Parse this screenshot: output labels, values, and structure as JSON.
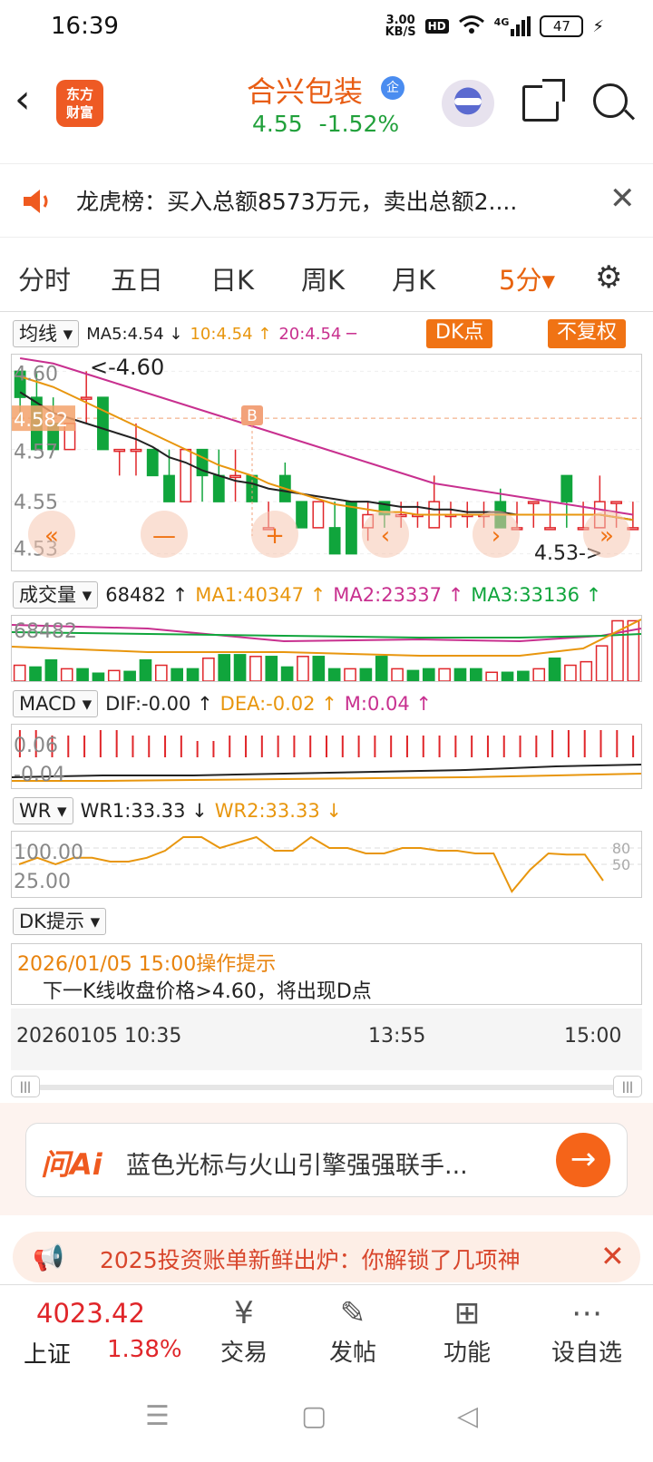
{
  "status_bar": {
    "time": "16:39",
    "speed_value": "3.00",
    "speed_unit": "KB/S",
    "hd": "HD",
    "network": "4G",
    "battery": "47"
  },
  "header": {
    "logo_text": "东方财富",
    "stock_name": "合兴包装",
    "badge": "企",
    "price": "4.55",
    "change_pct": "-1.52%"
  },
  "notice": {
    "text": "龙虎榜：买入总额8573万元，卖出总额2...."
  },
  "tabs": [
    {
      "label": "分时",
      "active": false
    },
    {
      "label": "五日",
      "active": false
    },
    {
      "label": "日K",
      "active": false
    },
    {
      "label": "周K",
      "active": false
    },
    {
      "label": "月K",
      "active": false
    },
    {
      "label": "5分▾",
      "active": true
    }
  ],
  "ma_row": {
    "dropdown": "均线",
    "ma5": "MA5:4.54 ↓",
    "ma10": "10:4.54 ↑",
    "ma20": "20:4.54 ─",
    "dk_button": "DK点",
    "fq_button": "不复权"
  },
  "vol_row": {
    "dropdown": "成交量",
    "value": "68482 ↑",
    "ma1": "MA1:40347 ↑",
    "ma2": "MA2:23337 ↑",
    "ma3": "MA3:33136 ↑"
  },
  "macd_row": {
    "dropdown": "MACD",
    "dif": "DIF:-0.00 ↑",
    "dea": "DEA:-0.02 ↑",
    "m": "M:0.04 ↑"
  },
  "wr_row": {
    "dropdown": "WR",
    "wr1": "WR1:33.33 ↓",
    "wr2": "WR2:33.33 ↓"
  },
  "dk_row": {
    "dropdown": "DK提示"
  },
  "dk_panel": {
    "title": "2026/01/05 15:00操作提示",
    "message": "下一K线收盘价格>4.60，将出现D点"
  },
  "time_axis": [
    "20260105 10:35",
    "13:55",
    "15:00"
  ],
  "ai_bar": {
    "logo": "问Ai",
    "text": "蓝色光标与火山引擎强强联手..."
  },
  "promo": {
    "text": "2025投资账单新鲜出炉：你解锁了几项神"
  },
  "bottom_nav": {
    "index_value": "4023.42",
    "index_name": "上证",
    "index_change": "1.38%",
    "items": [
      "交易",
      "发帖",
      "功能",
      "设自选"
    ]
  },
  "colors": {
    "up": "#e0262a",
    "down": "#10a53c",
    "accent": "#f07314",
    "ma5": "#222222",
    "ma10": "#e8960e",
    "ma20": "#c8308f"
  },
  "chart_data": [
    {
      "type": "candlestick",
      "title": "",
      "y_axis_labels": [
        "4.60",
        "4.582",
        "4.57",
        "4.55",
        "4.53"
      ],
      "annotations": [
        "<-4.60",
        "4.53->",
        "B"
      ],
      "ylim": [
        4.525,
        4.605
      ],
      "series": [
        {
          "name": "K",
          "ohlc": [
            [
              4.6,
              4.6,
              4.58,
              4.59
            ],
            [
              4.59,
              4.6,
              4.57,
              4.57
            ],
            [
              4.58,
              4.59,
              4.57,
              4.57
            ],
            [
              4.57,
              4.58,
              4.57,
              4.58
            ],
            [
              4.59,
              4.6,
              4.58,
              4.59
            ],
            [
              4.59,
              4.59,
              4.57,
              4.57
            ],
            [
              4.57,
              4.57,
              4.56,
              4.57
            ],
            [
              4.57,
              4.58,
              4.56,
              4.57
            ],
            [
              4.57,
              4.57,
              4.56,
              4.56
            ],
            [
              4.56,
              4.57,
              4.55,
              4.55
            ],
            [
              4.55,
              4.57,
              4.55,
              4.57
            ],
            [
              4.57,
              4.57,
              4.55,
              4.56
            ],
            [
              4.56,
              4.57,
              4.55,
              4.55
            ],
            [
              4.56,
              4.57,
              4.55,
              4.56
            ],
            [
              4.56,
              4.56,
              4.55,
              4.55
            ],
            [
              4.54,
              4.55,
              4.54,
              4.54
            ],
            [
              4.56,
              4.565,
              4.55,
              4.55
            ],
            [
              4.55,
              4.55,
              4.54,
              4.54
            ],
            [
              4.54,
              4.55,
              4.54,
              4.55
            ],
            [
              4.54,
              4.55,
              4.53,
              4.53
            ],
            [
              4.55,
              4.55,
              4.53,
              4.53
            ],
            [
              4.54,
              4.55,
              4.535,
              4.545
            ],
            [
              4.55,
              4.55,
              4.54,
              4.545
            ],
            [
              4.545,
              4.55,
              4.54,
              4.545
            ],
            [
              4.545,
              4.55,
              4.54,
              4.545
            ],
            [
              4.54,
              4.56,
              4.54,
              4.55
            ],
            [
              4.545,
              4.55,
              4.54,
              4.545
            ],
            [
              4.545,
              4.55,
              4.54,
              4.545
            ],
            [
              4.545,
              4.55,
              4.54,
              4.545
            ],
            [
              4.55,
              4.555,
              4.54,
              4.54
            ],
            [
              4.54,
              4.55,
              4.54,
              4.54
            ],
            [
              4.55,
              4.55,
              4.54,
              4.55
            ],
            [
              4.54,
              4.55,
              4.54,
              4.54
            ],
            [
              4.56,
              4.56,
              4.54,
              4.55
            ],
            [
              4.54,
              4.55,
              4.54,
              4.54
            ],
            [
              4.54,
              4.56,
              4.54,
              4.55
            ],
            [
              4.55,
              4.55,
              4.54,
              4.55
            ],
            [
              4.54,
              4.55,
              4.54,
              4.54
            ]
          ]
        },
        {
          "name": "MA5",
          "values": [
            4.592,
            4.588,
            4.584,
            4.582,
            4.58,
            4.578,
            4.576,
            4.574,
            4.571,
            4.567,
            4.565,
            4.562,
            4.56,
            4.558,
            4.557,
            4.555,
            4.554,
            4.553,
            4.552,
            4.551,
            4.55,
            4.55,
            4.549,
            4.548,
            4.548,
            4.547,
            4.547,
            4.546,
            4.546,
            4.546,
            4.545,
            4.545,
            4.545,
            4.545,
            4.545,
            4.545,
            4.544,
            4.543
          ]
        },
        {
          "name": "MA10",
          "values": [
            4.598,
            4.596,
            4.594,
            4.591,
            4.588,
            4.585,
            4.582,
            4.579,
            4.576,
            4.573,
            4.57,
            4.567,
            4.564,
            4.562,
            4.56,
            4.557,
            4.555,
            4.553,
            4.551,
            4.549,
            4.548,
            4.547,
            4.546,
            4.546,
            4.545,
            4.545,
            4.545,
            4.545,
            4.545,
            4.545,
            4.545,
            4.545,
            4.545,
            4.545,
            4.545,
            4.545,
            4.544,
            4.543
          ]
        },
        {
          "name": "MA20",
          "values": [
            4.605,
            4.604,
            4.603,
            4.601,
            4.599,
            4.597,
            4.595,
            4.593,
            4.591,
            4.589,
            4.587,
            4.585,
            4.583,
            4.581,
            4.579,
            4.577,
            4.575,
            4.573,
            4.571,
            4.569,
            4.567,
            4.565,
            4.563,
            4.561,
            4.559,
            4.557,
            4.556,
            4.555,
            4.554,
            4.553,
            4.552,
            4.551,
            4.55,
            4.549,
            4.548,
            4.547,
            4.546,
            4.545
          ]
        }
      ]
    },
    {
      "type": "bar",
      "title": "",
      "y_axis_labels": [
        "68482"
      ],
      "ylim": [
        0,
        70000
      ],
      "values": [
        18000,
        16000,
        24000,
        14000,
        14000,
        9000,
        12000,
        11000,
        24000,
        18000,
        14000,
        14000,
        26000,
        30000,
        30000,
        28000,
        28000,
        16000,
        28000,
        28000,
        14000,
        14000,
        14000,
        28000,
        14000,
        12000,
        14000,
        14000,
        14000,
        14000,
        10000,
        10000,
        11000,
        14000,
        26000,
        18000,
        22000,
        40000,
        68482,
        68482
      ]
    },
    {
      "type": "bar",
      "title": "",
      "y_axis_labels": [
        "0.06",
        "-0.04"
      ],
      "ylim": [
        -0.05,
        0.07
      ],
      "values": [
        0.05,
        0.05,
        0.04,
        0.04,
        0.04,
        0.05,
        0.05,
        0.04,
        0.04,
        0.04,
        0.04,
        0.03,
        0.03,
        0.04,
        0.04,
        0.04,
        0.04,
        0.04,
        0.04,
        0.04,
        0.04,
        0.04,
        0.04,
        0.04,
        0.04,
        0.04,
        0.04,
        0.04,
        0.04,
        0.04,
        0.04,
        0.04,
        0.04,
        0.05,
        0.05,
        0.05,
        0.05,
        0.05,
        0.04
      ]
    },
    {
      "type": "line",
      "title": "",
      "y_axis_labels": [
        "100.00",
        "25.00",
        "80",
        "50"
      ],
      "ylim": [
        0,
        100
      ],
      "values": [
        50,
        62,
        50,
        62,
        62,
        55,
        55,
        62,
        75,
        100,
        100,
        80,
        90,
        100,
        75,
        75,
        100,
        80,
        80,
        70,
        70,
        80,
        80,
        75,
        75,
        70,
        70,
        0,
        40,
        70,
        68,
        68,
        20
      ]
    }
  ]
}
